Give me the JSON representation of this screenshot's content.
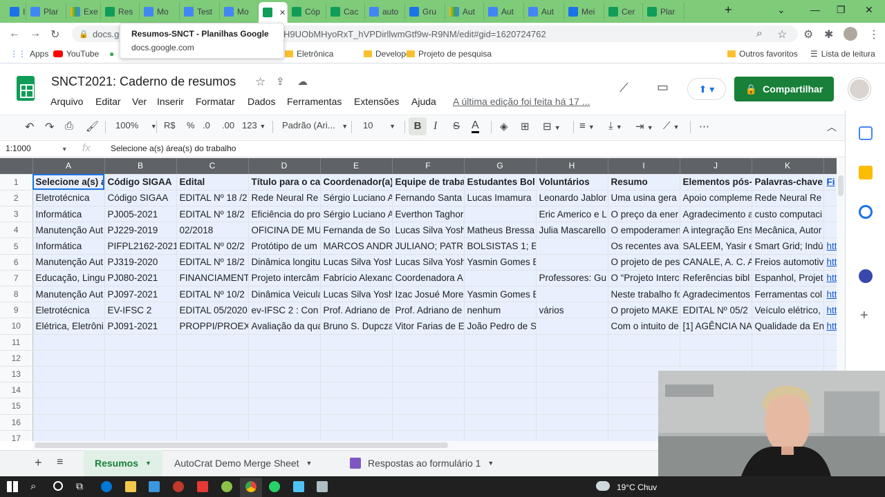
{
  "browser": {
    "tabs": [
      {
        "label": "IFSC",
        "icon": "other"
      },
      {
        "label": "Plar",
        "icon": "docs"
      },
      {
        "label": "Exe",
        "icon": "drive"
      },
      {
        "label": "Res",
        "icon": "sheets"
      },
      {
        "label": "Mo",
        "icon": "docs"
      },
      {
        "label": "Test",
        "icon": "docs"
      },
      {
        "label": "Mo",
        "icon": "docs"
      },
      {
        "label": "",
        "icon": "sheets",
        "active": true
      },
      {
        "label": "Cóp",
        "icon": "sheets"
      },
      {
        "label": "Cac",
        "icon": "sheets"
      },
      {
        "label": "auto",
        "icon": "docs"
      },
      {
        "label": "Gru",
        "icon": "other"
      },
      {
        "label": "Aut",
        "icon": "drive"
      },
      {
        "label": "Aut",
        "icon": "docs"
      },
      {
        "label": "Aut",
        "icon": "docs"
      },
      {
        "label": "Mei",
        "icon": "other"
      },
      {
        "label": "Cer",
        "icon": "sheets"
      },
      {
        "label": "Plar",
        "icon": "sheets"
      }
    ],
    "url": "docs.go",
    "url_tail": "H9UObMHyoRxT_hVPDirllwmGtf9w-R9NM/edit#gid=1620724762",
    "tooltip": {
      "title": "Resumos-SNCT - Planilhas Google",
      "domain": "docs.google.com"
    },
    "bookmarks": {
      "apps": "Apps",
      "youtube": "YouTube",
      "eletronica": "Eletrônica",
      "developer": "Developer",
      "projeto": "Projeto de pesquisa",
      "outros": "Outros favoritos",
      "leitura": "Lista de leitura"
    }
  },
  "sheets": {
    "title": "SNCT2021: Caderno de resumos",
    "menu": [
      "Arquivo",
      "Editar",
      "Ver",
      "Inserir",
      "Formatar",
      "Dados",
      "Ferramentas",
      "Extensões",
      "Ajuda"
    ],
    "last_edit": "A última edição foi feita há 17 ...",
    "share_label": "Compartilhar",
    "toolbar": {
      "zoom": "100%",
      "currency": "R$",
      "percent": "%",
      "dec_less": ".0",
      "dec_more": ".00",
      "format_more": "123",
      "font": "Padrão (Ari...",
      "size": "10",
      "bold": "B",
      "italic": "I",
      "strike": "S",
      "text_color": "A"
    },
    "name_box": "1:1000",
    "fx": "fx",
    "formula": "Selecione a(s) área(s) do trabalho",
    "columns": [
      "A",
      "B",
      "C",
      "D",
      "E",
      "F",
      "G",
      "H",
      "I",
      "J",
      "K",
      ""
    ],
    "rows": [
      [
        "Selecione a(s) á",
        "Código SIGAA",
        "Edital",
        "Título para o ca",
        "Coordenador(a)",
        "Equipe de traba",
        "Estudantes Bol",
        "Voluntários",
        "Resumo",
        "Elementos pós-",
        "Palavras-chave",
        "Fi"
      ],
      [
        "Eletrotécnica",
        "Código SIGAA",
        "EDITAL Nº 18 /2",
        "Rede Neural Re",
        "Sérgio Luciano A",
        "Fernando Santa",
        "Lucas Imamura",
        "Leonardo Jablor",
        "Uma usina gera",
        "Apoio compleme",
        "Rede Neural Re",
        ""
      ],
      [
        "Informática",
        "PJ005-2021",
        "EDITAL Nº 18/2",
        "Eficiência do pro",
        "Sérgio Luciano A",
        "Everthon Taghor",
        "",
        "Eric Americo e L",
        "O preço da ener",
        "Agradecimento a",
        "custo computaci",
        ""
      ],
      [
        "Manutenção Aut",
        "PJ229-2019",
        "02/2018",
        "OFICINA DE MU",
        "Fernanda de So",
        "Lucas Silva Yosh",
        "Matheus Bressa",
        "Julia Mascarello",
        "O empoderamen",
        "A integração Ens",
        "Mecânica, Autor",
        ""
      ],
      [
        "Informática",
        "PIFPL2162-2021",
        "EDITAL Nº 02/2",
        "Protótipo de um",
        "MARCOS ANDR",
        "JULIANO; PATR",
        "BOLSISTAS 1; E",
        "",
        "Os recentes ava",
        "SALEEM, Yasir e",
        "Smart Grid; Indú",
        "htt"
      ],
      [
        "Manutenção Aut",
        "PJ319-2020",
        "EDITAL Nº 18/2",
        "Dinâmica longitu",
        "Lucas Silva Yosh",
        "Lucas Silva Yosh",
        "Yasmin Gomes B",
        "",
        "O projeto de pes",
        "CANALE, A. C. A",
        "Freios automotiv",
        "htt"
      ],
      [
        "Educação, Lingu",
        "PJ080-2021",
        "FINANCIAMENT",
        "Projeto intercâm",
        "Fabrício Alexanc",
        "Coordenadora A",
        "",
        "Professores: Gu",
        "O “Projeto Interc",
        "Referências bibl",
        "Espanhol, Projet",
        "htt"
      ],
      [
        "Manutenção Aut",
        "PJ097-2021",
        "EDITAL Nº 10/2",
        "Dinâmica Veicula",
        "Lucas Silva Yosh",
        "Izac Josué More",
        "Yasmin Gomes B",
        "",
        "Neste trabalho fo",
        "Agradecimentos",
        "Ferramentas col",
        "htt"
      ],
      [
        "Eletrotécnica",
        "EV-IFSC 2",
        "EDITAL 05/2020",
        "ev-IFSC 2 : Con",
        "Prof. Adriano de",
        "Prof. Adriano de",
        "nenhum",
        "vários",
        "O projeto MAKE",
        "EDITAL Nº 05/2",
        "Veículo elétrico,",
        "htt"
      ],
      [
        "Elétrica, Eletrôni",
        "PJ091-2021",
        "PROPPI/PROEX",
        "Avaliação da qua",
        "Bruno S. Dupcza",
        "Vitor Farias de E",
        "João Pedro de S",
        "",
        "Com o intuito de",
        "[1] AGÊNCIA NA",
        "Qualidade da En",
        "htt"
      ],
      [
        "",
        "",
        "",
        "",
        "",
        "",
        "",
        "",
        "",
        "",
        "",
        ""
      ],
      [
        "",
        "",
        "",
        "",
        "",
        "",
        "",
        "",
        "",
        "",
        "",
        ""
      ],
      [
        "",
        "",
        "",
        "",
        "",
        "",
        "",
        "",
        "",
        "",
        "",
        ""
      ],
      [
        "",
        "",
        "",
        "",
        "",
        "",
        "",
        "",
        "",
        "",
        "",
        ""
      ],
      [
        "",
        "",
        "",
        "",
        "",
        "",
        "",
        "",
        "",
        "",
        "",
        ""
      ],
      [
        "",
        "",
        "",
        "",
        "",
        "",
        "",
        "",
        "",
        "",
        "",
        ""
      ],
      [
        "",
        "",
        "",
        "",
        "",
        "",
        "",
        "",
        "",
        "",
        "",
        ""
      ]
    ],
    "sheet_tabs": [
      "Resumos",
      "AutoCrat Demo Merge Sheet",
      "Respostas ao formulário 1"
    ]
  },
  "taskbar": {
    "weather": "19°C  Chuv"
  },
  "colors": {
    "sheets_green": "#188038",
    "selection": "#e8f0fe",
    "header_gray": "#5f6368"
  }
}
